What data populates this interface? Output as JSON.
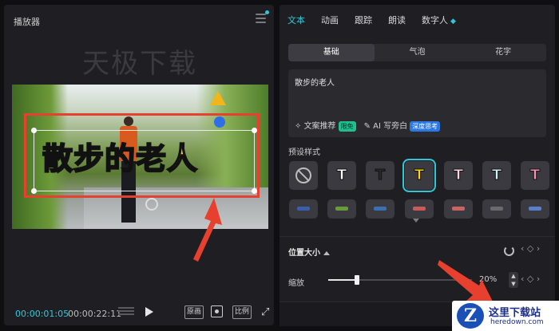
{
  "player": {
    "title": "播放器",
    "watermark": "天极下载",
    "caption": "散步的老人",
    "time_current": "00:00:01:05",
    "time_total": "00:00:22:11",
    "original_label": "原画",
    "ratio_label": "比例"
  },
  "props": {
    "tabs": [
      {
        "label": "文本",
        "active": true
      },
      {
        "label": "动画"
      },
      {
        "label": "跟踪"
      },
      {
        "label": "朗读"
      },
      {
        "label": "数字人"
      }
    ],
    "sub_tabs": [
      "基础",
      "气泡",
      "花字"
    ],
    "text_value": "散步的老人",
    "tool_recommend": "文案推荐",
    "badge_free": "限免",
    "tool_ai": "AI 写旁白",
    "badge_deep": "深度思考",
    "preset_title": "预设样式",
    "presets": [
      {
        "label": "",
        "type": "none"
      },
      {
        "label": "T",
        "color": "#ffffff"
      },
      {
        "label": "T",
        "color": "#2a2a2a"
      },
      {
        "label": "T",
        "color": "#ffd21a",
        "selected": true
      },
      {
        "label": "T",
        "color": "#ffd6e0"
      },
      {
        "label": "T",
        "color": "#d0efff"
      },
      {
        "label": "T",
        "color": "#ff8fb8"
      }
    ],
    "preset_row2_colors": [
      "#3a5fa8",
      "#6a9a3a",
      "#3a6fb0",
      "#c85a5a",
      "#c86464",
      "#6a6a6a",
      "#5a7fc8"
    ],
    "position_title": "位置大小",
    "scale_label": "缩放",
    "scale_value": 0.2,
    "scale_text": "20%"
  },
  "logo": {
    "letter": "Z",
    "title": "这里下载站",
    "url": "heredown.com"
  },
  "colors": {
    "accent": "#2fc7d8",
    "annotation": "#e8402e"
  }
}
